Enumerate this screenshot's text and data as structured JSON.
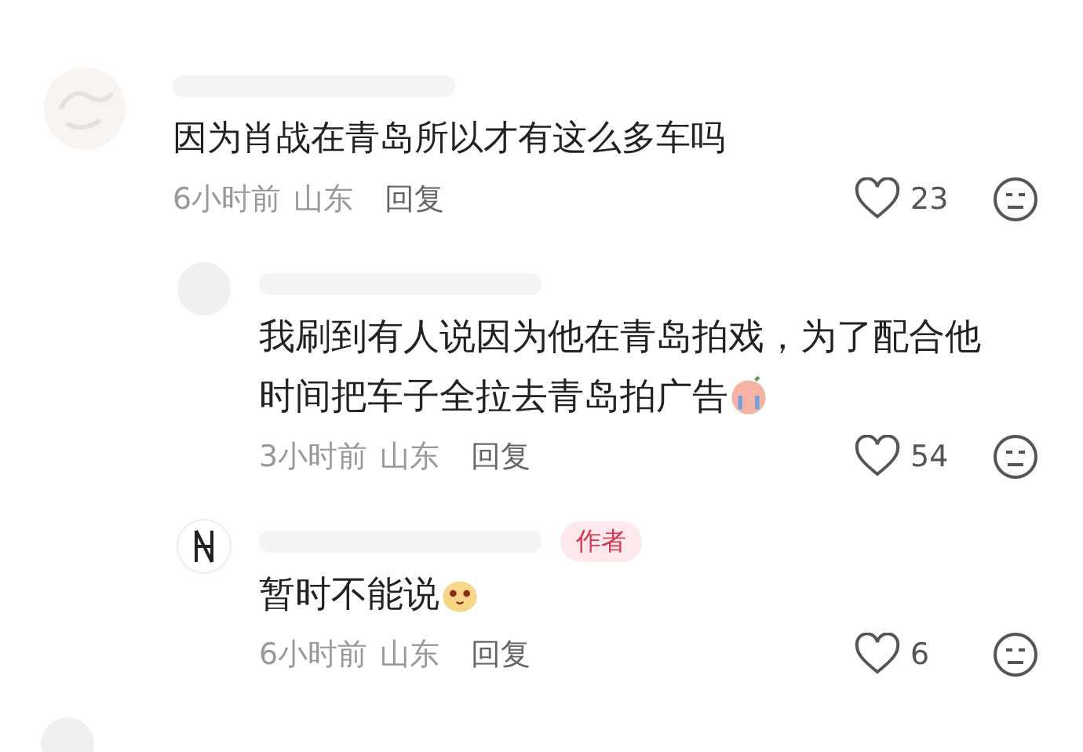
{
  "comments": [
    {
      "avatar": {
        "kind": "sketch"
      },
      "text": "因为肖战在青岛所以才有这么多车吗",
      "time": "6小时前",
      "location": "山东",
      "reply": "回复",
      "likes": "23",
      "children": [
        {
          "avatar": {
            "kind": "faded"
          },
          "text": "我刷到有人说因为他在青岛拍戏，为了配合他时间把车子全拉去青岛拍广告",
          "emoji": {
            "kind": "crying"
          },
          "time": "3小时前",
          "location": "山东",
          "reply": "回复",
          "likes": "54"
        },
        {
          "avatar": {
            "kind": "logo"
          },
          "badge": "作者",
          "text": "暂时不能说",
          "emoji": {
            "kind": "smug"
          },
          "time": "6小时前",
          "location": "山东",
          "reply": "回复",
          "likes": "6"
        }
      ]
    },
    {
      "avatar": {
        "kind": "faded"
      }
    }
  ]
}
